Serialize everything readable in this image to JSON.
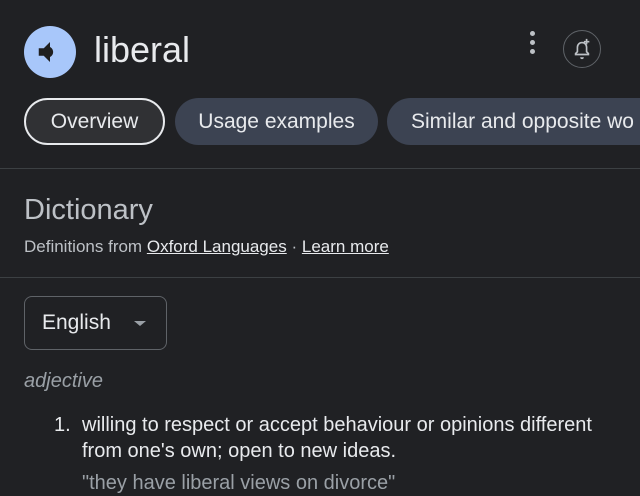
{
  "entry": {
    "word": "liberal",
    "speaker_icon": "volume-up-icon",
    "more_icon": "more-vert-icon",
    "bell_icon": "add-alert-icon"
  },
  "chips": [
    {
      "label": "Overview",
      "active": true
    },
    {
      "label": "Usage examples",
      "active": false
    },
    {
      "label": "Similar and opposite wo",
      "active": false
    }
  ],
  "dictionary": {
    "title": "Dictionary",
    "source_prefix": "Definitions from",
    "source_link": "Oxford Languages",
    "separator": "·",
    "learn_more": "Learn more"
  },
  "language": {
    "selected": "English",
    "icon": "dropdown-caret-icon"
  },
  "definitions": {
    "part_of_speech": "adjective",
    "items": [
      {
        "number": "1.",
        "text": "willing to respect or accept behaviour or opinions different from one's own; open to new ideas.",
        "example": "\"they have liberal views on divorce\""
      }
    ]
  },
  "colors": {
    "background": "#202124",
    "speaker_bg": "#a8c7fa",
    "chip_bg": "#3c4352",
    "text": "#e8eaed",
    "muted": "#9aa0a6"
  }
}
